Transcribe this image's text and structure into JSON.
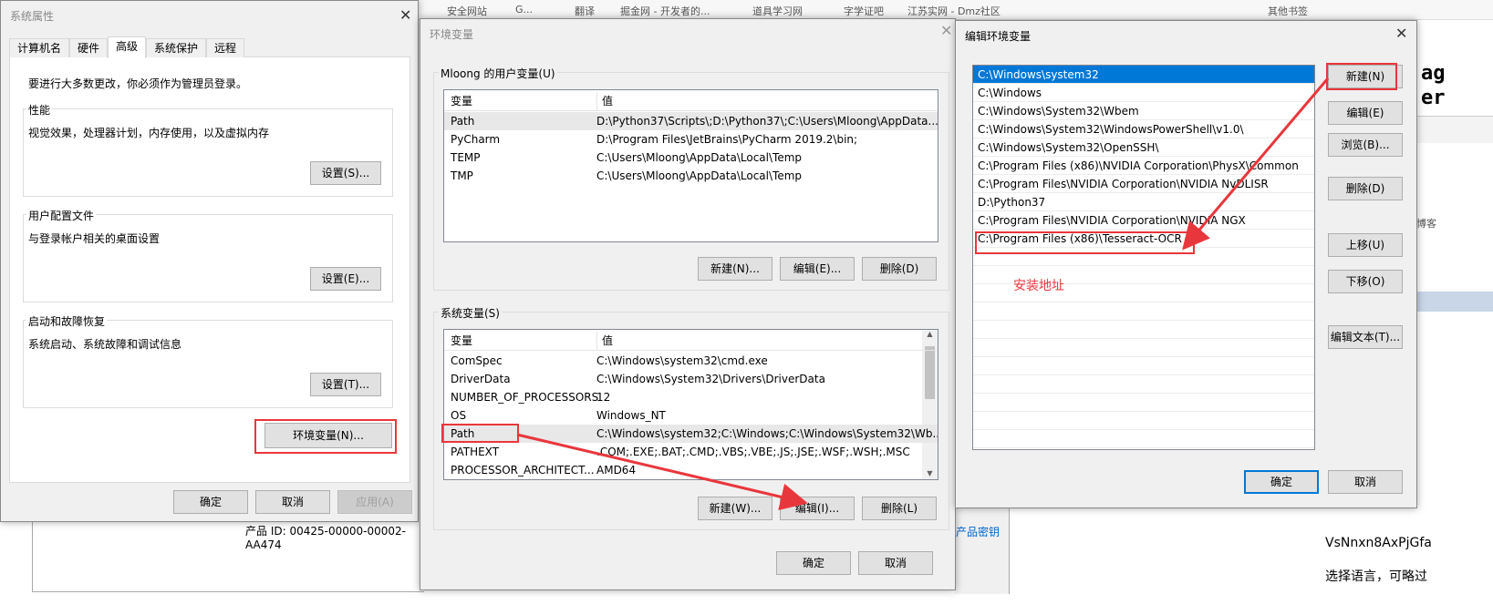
{
  "background": {
    "bookmarks": [
      "安全网站",
      "G...",
      "翻译",
      "掘金网 - 开发者的...",
      "道具学习网",
      "字学证吧",
      "江苏实网 - Dmz社区",
      "其他书签"
    ],
    "product_id": "产品 ID: 00425-00000-00002-AA474",
    "product_key_link": "产品密钥",
    "right_code": [
      "ag",
      "er",
      "g"
    ],
    "right_blog": "博客",
    "right_text1": "VsNnxn8AxPjGfa",
    "right_text2": "选择语言，可略过"
  },
  "sysprops": {
    "title": "系统属性",
    "tabs": [
      "计算机名",
      "硬件",
      "高级",
      "系统保护",
      "远程"
    ],
    "active_tab": "高级",
    "admin_note": "要进行大多数更改，你必须作为管理员登录。",
    "groups": [
      {
        "label": "性能",
        "desc": "视觉效果，处理器计划，内存使用，以及虚拟内存",
        "button": "设置(S)..."
      },
      {
        "label": "用户配置文件",
        "desc": "与登录帐户相关的桌面设置",
        "button": "设置(E)..."
      },
      {
        "label": "启动和故障恢复",
        "desc": "系统启动、系统故障和调试信息",
        "button": "设置(T)..."
      }
    ],
    "env_button": "环境变量(N)...",
    "ok": "确定",
    "cancel": "取消",
    "apply": "应用(A)"
  },
  "envvars": {
    "title": "环境变量",
    "user_group": "Mloong 的用户变量(U)",
    "col_var": "变量",
    "col_val": "值",
    "user_vars": [
      {
        "name": "Path",
        "value": "D:\\Python37\\Scripts\\;D:\\Python37\\;C:\\Users\\Mloong\\AppData..."
      },
      {
        "name": "PyCharm",
        "value": "D:\\Program Files\\JetBrains\\PyCharm 2019.2\\bin;"
      },
      {
        "name": "TEMP",
        "value": "C:\\Users\\Mloong\\AppData\\Local\\Temp"
      },
      {
        "name": "TMP",
        "value": "C:\\Users\\Mloong\\AppData\\Local\\Temp"
      }
    ],
    "user_buttons": [
      "新建(N)...",
      "编辑(E)...",
      "删除(D)"
    ],
    "sys_group": "系统变量(S)",
    "sys_vars": [
      {
        "name": "ComSpec",
        "value": "C:\\Windows\\system32\\cmd.exe"
      },
      {
        "name": "DriverData",
        "value": "C:\\Windows\\System32\\Drivers\\DriverData"
      },
      {
        "name": "NUMBER_OF_PROCESSORS",
        "value": "12"
      },
      {
        "name": "OS",
        "value": "Windows_NT"
      },
      {
        "name": "Path",
        "value": "C:\\Windows\\system32;C:\\Windows;C:\\Windows\\System32\\Wb..."
      },
      {
        "name": "PATHEXT",
        "value": ".COM;.EXE;.BAT;.CMD;.VBS;.VBE;.JS;.JSE;.WSF;.WSH;.MSC"
      },
      {
        "name": "PROCESSOR_ARCHITECT...",
        "value": "AMD64"
      }
    ],
    "sys_buttons": [
      "新建(W)...",
      "编辑(I)...",
      "删除(L)"
    ],
    "ok": "确定",
    "cancel": "取消"
  },
  "editenv": {
    "title": "编辑环境变量",
    "paths": [
      "C:\\Windows\\system32",
      "C:\\Windows",
      "C:\\Windows\\System32\\Wbem",
      "C:\\Windows\\System32\\WindowsPowerShell\\v1.0\\",
      "C:\\Windows\\System32\\OpenSSH\\",
      "C:\\Program Files (x86)\\NVIDIA Corporation\\PhysX\\Common",
      "C:\\Program Files\\NVIDIA Corporation\\NVIDIA NvDLISR",
      "D:\\Python37",
      "C:\\Program Files\\NVIDIA Corporation\\NVIDIA NGX",
      "C:\\Program Files (x86)\\Tesseract-OCR"
    ],
    "selected_index": 0,
    "buttons": [
      "新建(N)",
      "编辑(E)",
      "浏览(B)...",
      "删除(D)",
      "上移(U)",
      "下移(O)",
      "编辑文本(T)..."
    ],
    "ok": "确定",
    "cancel": "取消"
  },
  "annotation": {
    "label": "安装地址",
    "color": "#e8373c"
  },
  "colors": {
    "selection": "#0078d7",
    "annotation": "#e8373c"
  }
}
